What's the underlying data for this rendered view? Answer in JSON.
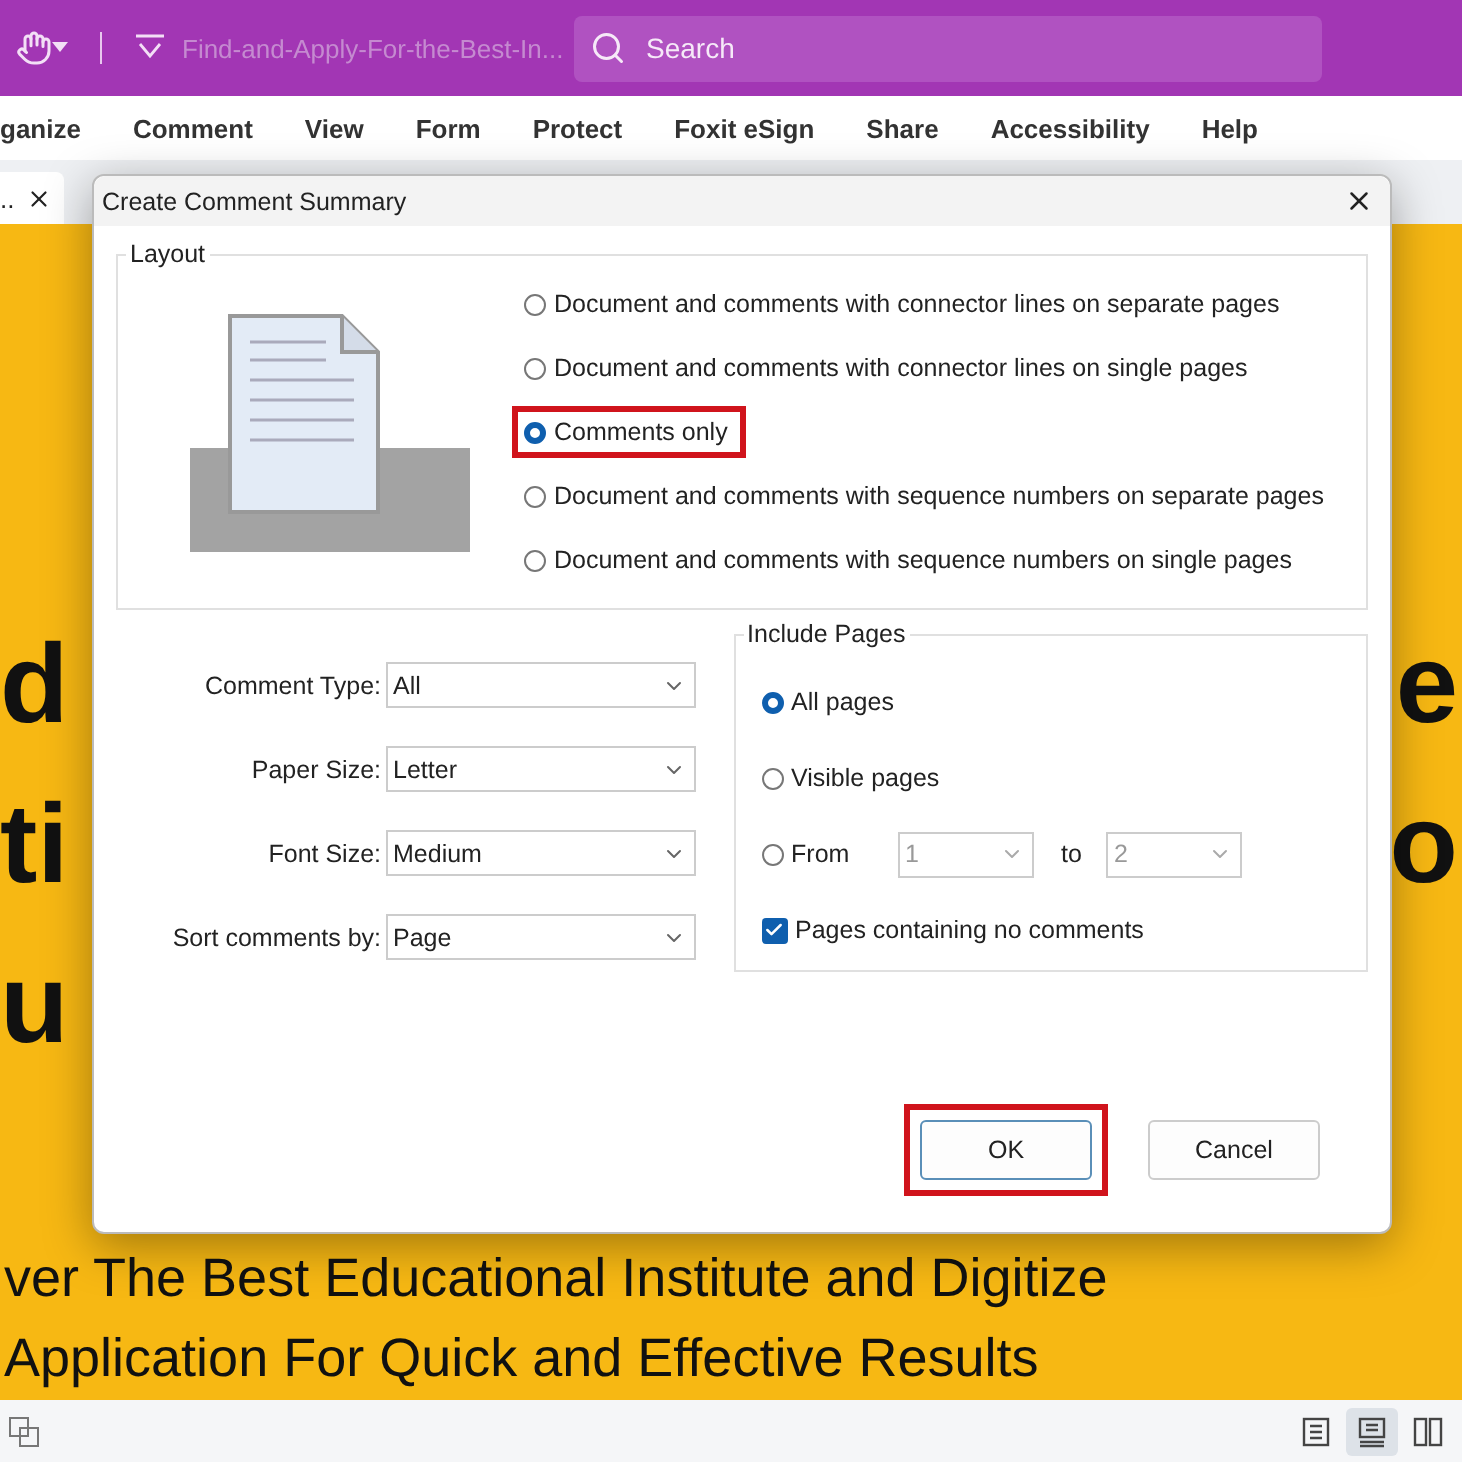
{
  "top_bar": {
    "title": "Find-and-Apply-For-the-Best-In...",
    "search": {
      "placeholder": "Search"
    }
  },
  "menu": [
    "ganize",
    "Comment",
    "View",
    "Form",
    "Protect",
    "Foxit eSign",
    "Share",
    "Accessibility",
    "Help"
  ],
  "doc_tab": {
    "label": ".."
  },
  "document": {
    "rows": [
      {
        "left": "d",
        "right": "e"
      },
      {
        "left": "ti",
        "right": "o"
      },
      {
        "left": "u"
      }
    ],
    "lines": [
      "ver The Best Educational Institute and Digitize",
      "Application For Quick and Effective Results"
    ]
  },
  "dialog": {
    "title": "Create Comment Summary",
    "layout": {
      "legend": "Layout",
      "options": [
        {
          "label": "Document and comments with connector lines on separate pages",
          "selected": false,
          "highlighted": false
        },
        {
          "label": "Document and comments with connector lines on single pages",
          "selected": false,
          "highlighted": false
        },
        {
          "label": "Comments only",
          "selected": true,
          "highlighted": true
        },
        {
          "label": "Document and comments with sequence numbers on separate pages",
          "selected": false,
          "highlighted": false
        },
        {
          "label": "Document and comments with sequence numbers on single pages",
          "selected": false,
          "highlighted": false
        }
      ]
    },
    "fields": [
      {
        "label": "Comment Type:",
        "value": "All"
      },
      {
        "label": "Paper Size:",
        "value": "Letter"
      },
      {
        "label": "Font Size:",
        "value": "Medium"
      },
      {
        "label": "Sort comments by:",
        "value": "Page"
      }
    ],
    "include_pages": {
      "legend": "Include Pages",
      "options": [
        {
          "kind": "plain",
          "label": "All pages",
          "selected": true
        },
        {
          "kind": "plain",
          "label": "Visible pages",
          "selected": false
        },
        {
          "kind": "range",
          "label": "From",
          "selected": false,
          "from": "1",
          "to_label": "to",
          "to": "2"
        }
      ],
      "checkbox": {
        "label": "Pages containing no comments",
        "checked": true
      }
    },
    "buttons": [
      {
        "label": "OK",
        "highlighted": true
      },
      {
        "label": "Cancel",
        "highlighted": false
      }
    ]
  },
  "view_modes": [
    {
      "selected": false
    },
    {
      "selected": true
    },
    {
      "selected": false
    }
  ]
}
